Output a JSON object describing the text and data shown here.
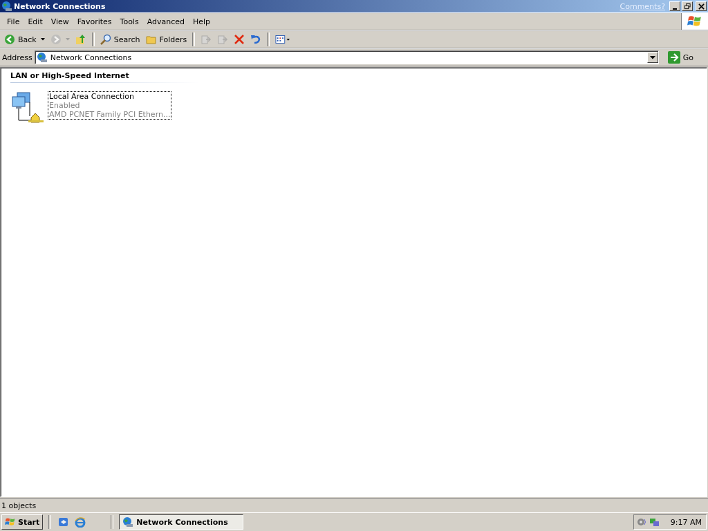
{
  "window": {
    "title": "Network Connections",
    "comments_link": "Comments?"
  },
  "menu": [
    {
      "label": "File"
    },
    {
      "label": "Edit"
    },
    {
      "label": "View"
    },
    {
      "label": "Favorites"
    },
    {
      "label": "Tools"
    },
    {
      "label": "Advanced"
    },
    {
      "label": "Help"
    }
  ],
  "toolbar": [
    {
      "kind": "back",
      "label": "Back",
      "disabled": false
    },
    {
      "kind": "forward",
      "disabled": true
    },
    {
      "kind": "up",
      "disabled": false
    },
    {
      "kind": "sep"
    },
    {
      "kind": "search",
      "label": "Search",
      "disabled": false
    },
    {
      "kind": "folders",
      "label": "Folders",
      "disabled": false
    },
    {
      "kind": "sep"
    },
    {
      "kind": "move",
      "disabled": true
    },
    {
      "kind": "copy",
      "disabled": true
    },
    {
      "kind": "delete",
      "disabled": false
    },
    {
      "kind": "undo",
      "disabled": false
    },
    {
      "kind": "sep"
    },
    {
      "kind": "views",
      "disabled": false
    }
  ],
  "address": {
    "label": "Address",
    "value": "Network Connections",
    "go": "Go"
  },
  "group": {
    "title": "LAN or High-Speed Internet",
    "items": [
      {
        "name": "Local Area Connection",
        "status": "Enabled",
        "device": "AMD PCNET Family PCI Ethern...",
        "selected": true
      }
    ]
  },
  "status_bar": {
    "text": "1 objects"
  },
  "taskbar": {
    "start": "Start",
    "tasks": [
      {
        "label": "Network Connections",
        "selected": true
      }
    ],
    "clock": "9:17 AM"
  }
}
